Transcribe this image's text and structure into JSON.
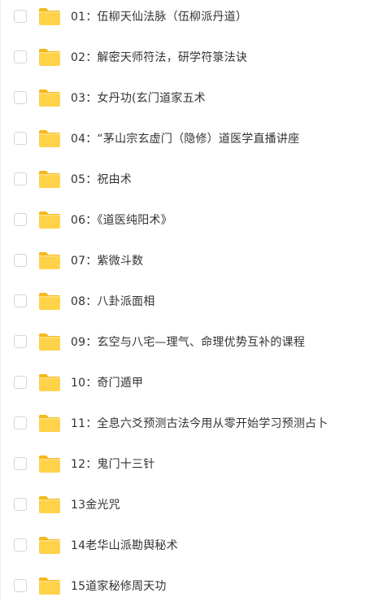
{
  "colors": {
    "folder_body": "#FFD24A",
    "folder_tab": "#F5B81C",
    "text": "#333333",
    "checkbox_border": "#D6D6D6"
  },
  "items": [
    {
      "name": "01：伍柳天仙法脉（伍柳派丹道）",
      "icon": "folder-icon",
      "checked": false
    },
    {
      "name": "02：解密天师符法，研学符箓法诀",
      "icon": "folder-icon",
      "checked": false
    },
    {
      "name": "03：女丹功(玄门道家五术",
      "icon": "folder-icon",
      "checked": false
    },
    {
      "name": "04：“茅山宗玄虚门（隐修）道医学直播讲座",
      "icon": "folder-icon",
      "checked": false
    },
    {
      "name": "05：祝由术",
      "icon": "folder-icon",
      "checked": false
    },
    {
      "name": "06：《道医纯阳术》",
      "icon": "folder-icon",
      "checked": false
    },
    {
      "name": "07：紫微斗数",
      "icon": "folder-icon",
      "checked": false
    },
    {
      "name": "08：八卦派面相",
      "icon": "folder-icon",
      "checked": false
    },
    {
      "name": "09：玄空与八宅—理气、命理优势互补的课程",
      "icon": "folder-icon",
      "checked": false
    },
    {
      "name": "10：奇门遁甲",
      "icon": "folder-icon",
      "checked": false
    },
    {
      "name": "11：全息六爻预测古法今用从零开始学习预测占卜",
      "icon": "folder-icon",
      "checked": false
    },
    {
      "name": "12：鬼门十三针",
      "icon": "folder-icon",
      "checked": false
    },
    {
      "name": "13金光咒",
      "icon": "folder-icon",
      "checked": false
    },
    {
      "name": "14老华山派勘舆秘术",
      "icon": "folder-icon",
      "checked": false
    },
    {
      "name": "15道家秘修周天功",
      "icon": "folder-icon",
      "checked": false
    }
  ]
}
